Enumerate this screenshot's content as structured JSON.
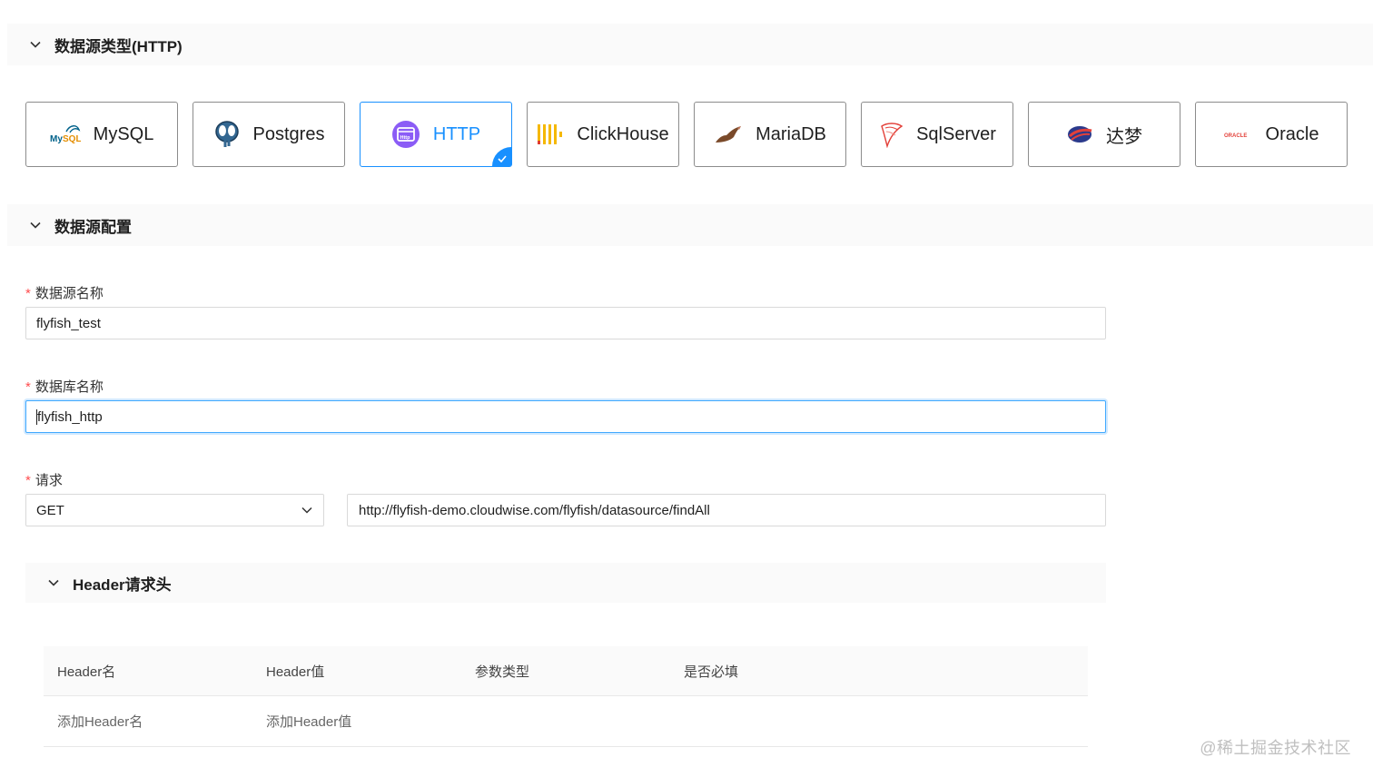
{
  "sections": {
    "type_section_title": "数据源类型(HTTP)",
    "config_section_title": "数据源配置"
  },
  "datasource_types": [
    {
      "label": "MySQL",
      "icon": "mysql-icon",
      "selected": false
    },
    {
      "label": "Postgres",
      "icon": "postgres-icon",
      "selected": false
    },
    {
      "label": "HTTP",
      "icon": "http-icon",
      "selected": true
    },
    {
      "label": "ClickHouse",
      "icon": "clickhouse-icon",
      "selected": false
    },
    {
      "label": "MariaDB",
      "icon": "mariadb-icon",
      "selected": false
    },
    {
      "label": "SqlServer",
      "icon": "sqlserver-icon",
      "selected": false
    },
    {
      "label": "达梦",
      "icon": "dameng-icon",
      "selected": false
    },
    {
      "label": "Oracle",
      "icon": "oracle-icon",
      "selected": false
    }
  ],
  "logo_text": {
    "mysql_my": "My",
    "mysql_sql": "SQL",
    "http": "Http",
    "oracle": "ORACLE"
  },
  "form": {
    "required_mark": "*",
    "name_label": "数据源名称",
    "name_value": "flyfish_test",
    "db_label": "数据库名称",
    "db_value": "flyfish_http",
    "request_label": "请求",
    "method_value": "GET",
    "url_value": "http://flyfish-demo.cloudwise.com/flyfish/datasource/findAll"
  },
  "header_section": {
    "title": "Header请求头",
    "columns": [
      "Header名",
      "Header值",
      "参数类型",
      "是否必填"
    ],
    "add_name_placeholder": "添加Header名",
    "add_value_placeholder": "添加Header值"
  },
  "watermark": "@稀土掘金技术社区",
  "colors": {
    "accent": "#1890ff",
    "required": "#ff4d4f",
    "header_bg": "#fafafa"
  }
}
